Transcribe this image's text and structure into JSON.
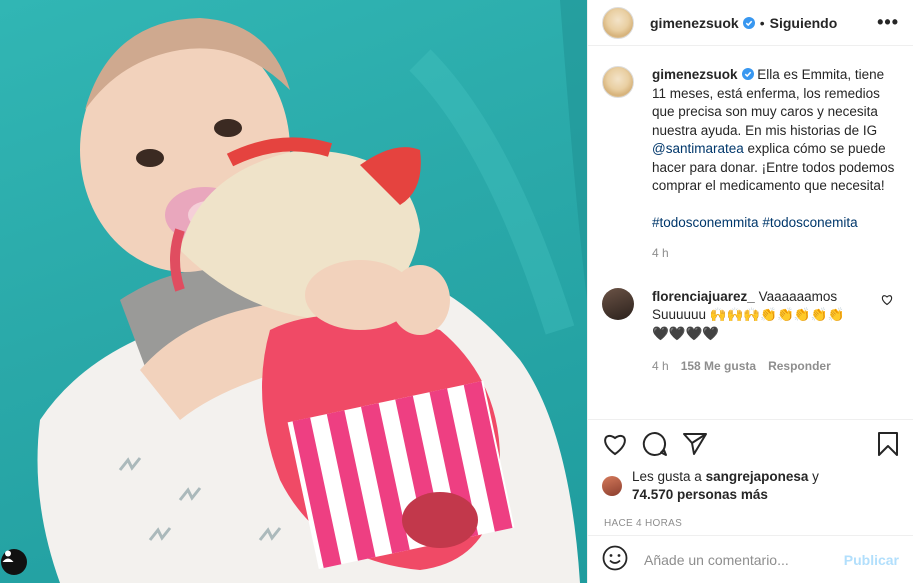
{
  "post": {
    "username": "gimenezsuok",
    "follow_status": "Siguiendo",
    "dot": "•",
    "more": "•••"
  },
  "caption": {
    "username": "gimenezsuok",
    "text_a": "Ella es Emmita, tiene 11 meses, está enferma, los remedios que precisa son muy caros y necesita nuestra ayuda. En mis historias de IG ",
    "mention": "@santimaratea",
    "text_b": " explica cómo se puede hacer para donar. ¡Entre todos podemos comprar el medicamento que necesita!",
    "hashtag1": "#todosconemmita",
    "hashtag2": "#todosconemita",
    "time": "4 h"
  },
  "reply": {
    "username": "florenciajuarez_",
    "text": "Vaaaaaamos Suuuuuu 🙌🙌🙌👏👏👏👏👏 🖤🖤🖤🖤",
    "time": "4 h",
    "likes": "158 Me gusta",
    "reply_label": "Responder"
  },
  "likes": {
    "prefix": "Les gusta a ",
    "user": "sangrejaponesa",
    "middle": " y",
    "others": "74.570 personas más"
  },
  "timestamp": "HACE 4 HORAS",
  "comment_box": {
    "placeholder": "Añade un comentario...",
    "publish": "Publicar"
  },
  "colors": {
    "link": "#00376b",
    "verified": "#3897f0",
    "publish_disabled": "#b2dffc",
    "muted": "#8e8e8e"
  },
  "icons": [
    "heart-icon",
    "comment-icon",
    "share-icon",
    "bookmark-icon",
    "emoji-icon",
    "user-tag-icon",
    "verified-icon",
    "more-icon"
  ]
}
